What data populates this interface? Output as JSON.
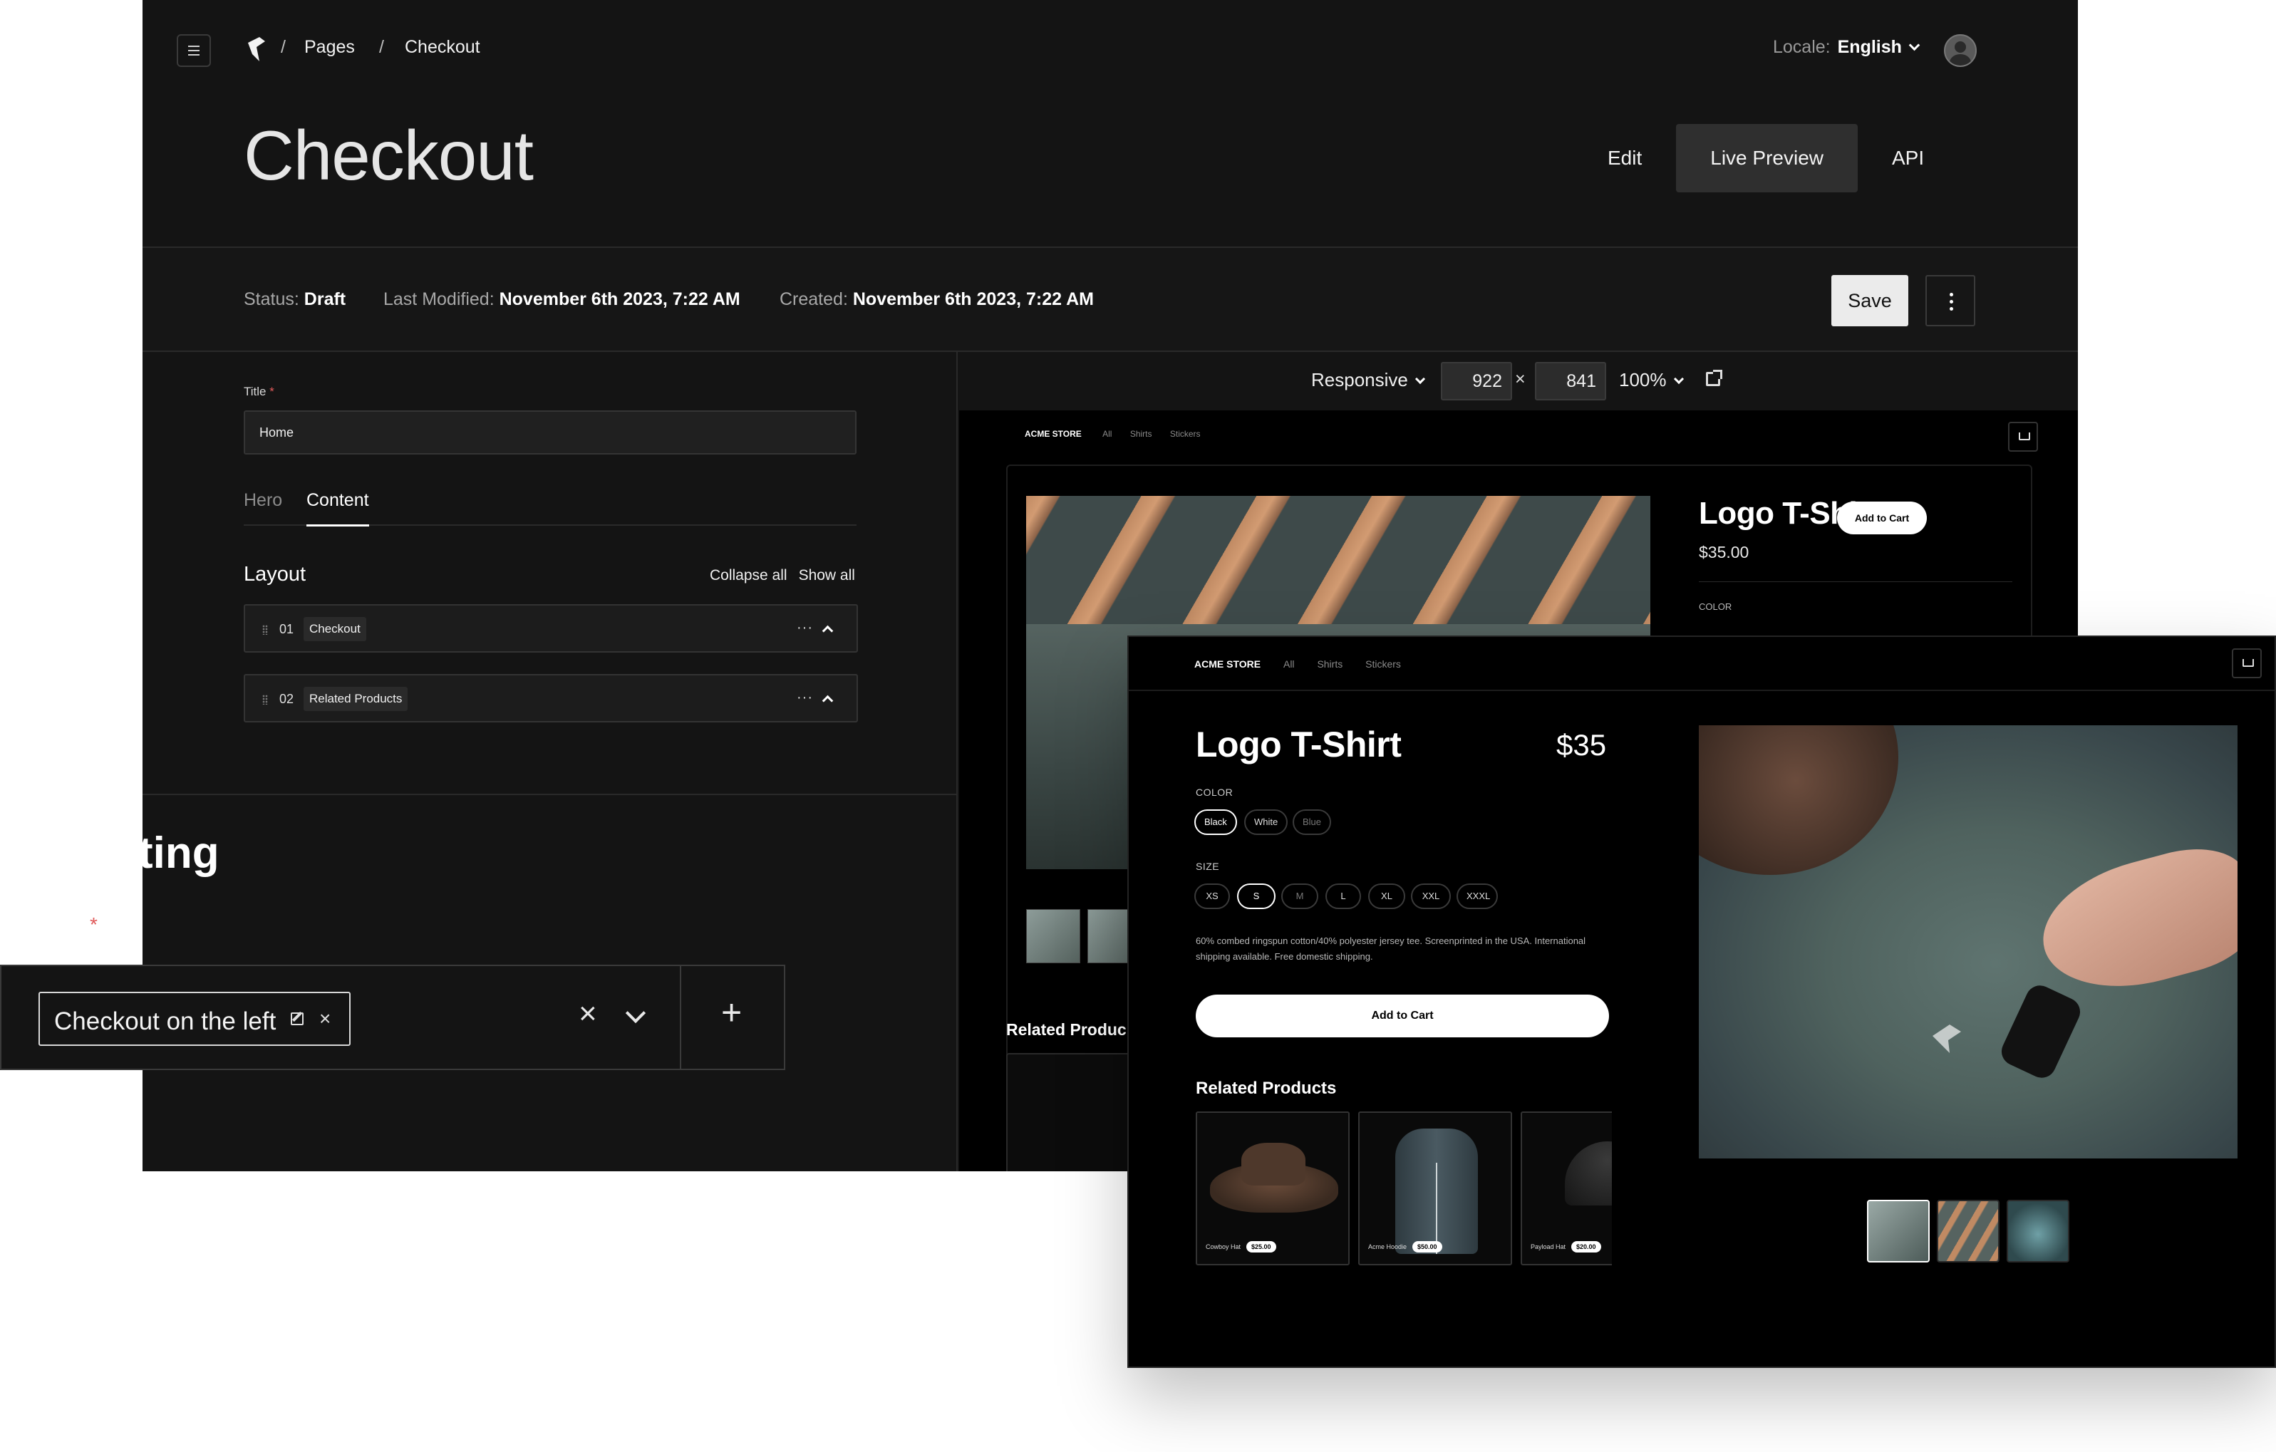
{
  "admin": {
    "breadcrumb": {
      "sep": "/",
      "pages": "Pages",
      "current": "Checkout"
    },
    "locale": {
      "label": "Locale:",
      "value": "English"
    },
    "page_title": "Checkout",
    "view_tabs": [
      {
        "label": "Edit"
      },
      {
        "label": "Live Preview",
        "active": true
      },
      {
        "label": "API"
      }
    ],
    "meta": {
      "status_label": "Status:",
      "status_value": "Draft",
      "modified_label": "Last Modified:",
      "modified_value": "November 6th 2023, 7:22 AM",
      "created_label": "Created:",
      "created_value": "November 6th 2023, 7:22 AM"
    },
    "save_label": "Save",
    "editor": {
      "title_label": "Title",
      "title_required": "*",
      "title_value": "Home",
      "tabs": [
        {
          "label": "Hero"
        },
        {
          "label": "Content",
          "active": true
        }
      ],
      "layout_label": "Layout",
      "collapse_all": "Collapse all",
      "show_all": "Show all",
      "blocks": [
        {
          "num": "01",
          "name": "Checkout"
        },
        {
          "num": "02",
          "name": "Related Products"
        }
      ],
      "more_glyph": "···",
      "partial_heading": "ting"
    },
    "preview_toolbar": {
      "mode": "Responsive",
      "width": "922",
      "times": "×",
      "height": "841",
      "zoom": "100%"
    },
    "preview_bg": {
      "store_name": "ACME STORE",
      "nav": [
        "All",
        "Shirts",
        "Stickers"
      ],
      "product_title": "Logo T-Shirt",
      "price": "$35.00",
      "add_to_cart": "Add to Cart",
      "color_label": "COLOR",
      "related": "Related Produc"
    }
  },
  "relationship": {
    "required": "*",
    "chip_label": "Checkout on the left",
    "remove_glyph": "×",
    "clear_glyph": "×",
    "add_glyph": "+"
  },
  "storefront": {
    "store_name": "ACME STORE",
    "nav": [
      "All",
      "Shirts",
      "Stickers"
    ],
    "product_title": "Logo T-Shirt",
    "price": "$35",
    "color_label": "COLOR",
    "colors": [
      {
        "label": "Black",
        "selected": true
      },
      {
        "label": "White"
      },
      {
        "label": "Blue",
        "disabled": true
      }
    ],
    "size_label": "SIZE",
    "sizes": [
      {
        "label": "XS"
      },
      {
        "label": "S",
        "selected": true
      },
      {
        "label": "M",
        "disabled": true
      },
      {
        "label": "L"
      },
      {
        "label": "XL"
      },
      {
        "label": "XXL"
      },
      {
        "label": "XXXL"
      }
    ],
    "description": "60% combed ringspun cotton/40% polyester jersey tee. Screenprinted in the USA. International shipping available. Free domestic shipping.",
    "add_to_cart": "Add to Cart",
    "related_title": "Related Products",
    "related": [
      {
        "name": "Cowboy Hat",
        "price": "$25.00"
      },
      {
        "name": "Acme Hoodie",
        "price": "$50.00"
      },
      {
        "name": "Payload Hat",
        "price": "$20.00"
      }
    ]
  },
  "colors": {
    "admin_bg": "#141414",
    "storefront_bg": "#000000",
    "required": "#e05a5a"
  }
}
